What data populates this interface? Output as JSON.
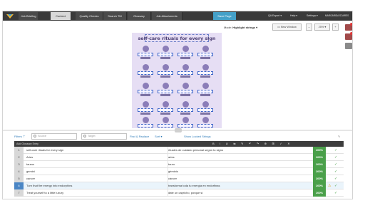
{
  "nav": {
    "tabs": [
      "Job Briefing",
      "Context",
      "Quality Checks",
      "Search TM",
      "Glossary",
      "Job Attachments"
    ],
    "active_tab": "Context",
    "save_label": "Save Page",
    "qa_export": "QA Export ▾",
    "help": "Help ▾",
    "settings": "Settings ▾",
    "user": "MARGARIDA SOARES"
  },
  "toolbar": {
    "mode_label": "Mode: ",
    "mode_value": "Highlight strings ▾",
    "new_window": "New Window",
    "minus": "–",
    "zoom": "25% ▾",
    "plus": "+"
  },
  "preview": {
    "title": "self-care rituals for every sign"
  },
  "filters": {
    "filters_label": "Filters ⊤",
    "source_placeholder": "Source",
    "target_placeholder": "Target",
    "find_replace": "Find & Replace",
    "sort": "Sort ▾",
    "show_locked": "Show Locked Strings"
  },
  "grid": {
    "header_label": "Add Glossary Entry",
    "tools": "B I U ⇆ ✎ ↶ ↷ ⊕ ⊞ ✓ ✕",
    "rows": [
      {
        "num": "1",
        "source": "self-care rituals for every sign",
        "target": "rituales de cuidado personal según tu signo",
        "pct": "100%"
      },
      {
        "num": "2",
        "source": "Aries",
        "target": "aries",
        "pct": "100%"
      },
      {
        "num": "3",
        "source": "taurus",
        "target": "tauro",
        "pct": "100%"
      },
      {
        "num": "4",
        "source": "gemini",
        "target": "géminis",
        "pct": "100%"
      },
      {
        "num": "5",
        "source": "cancer",
        "target": "cáncer",
        "pct": "100%"
      },
      {
        "num": "6",
        "source": "Turn that fire energy into endorphins",
        "target": "transforma toda tu energía en endorfinas",
        "pct": "100%"
      },
      {
        "num": "7",
        "source": "Treat yourself to a little luxury",
        "target": "date un capricho, porque sí",
        "pct": "100%"
      }
    ]
  },
  "colors": {
    "nav_bg": "#3a3a3a",
    "save_button": "#44a0c8",
    "match_green": "#4aa04a",
    "preview_bg": "#e6def4",
    "preview_text": "#4d3f74"
  }
}
